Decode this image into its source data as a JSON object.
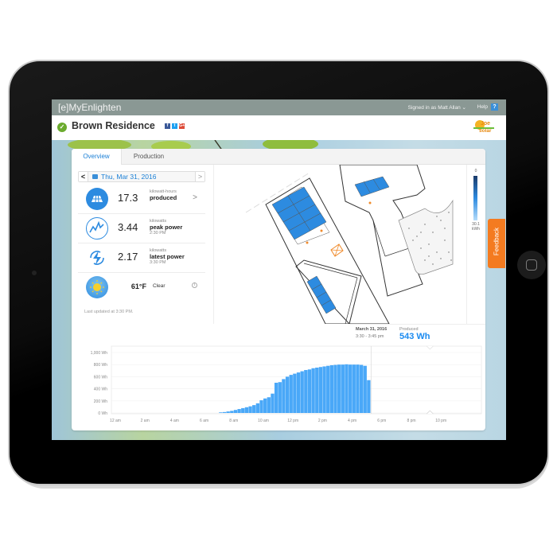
{
  "app": {
    "logo": "[e]MyEnlighten",
    "signed_in": "Signed in as Matt Allan ⌄",
    "help_label": "Help",
    "help_icon": "?"
  },
  "site": {
    "title": "Brown Residence",
    "status": "ok",
    "social": [
      "f",
      "t",
      "G+"
    ],
    "installer_logo_line1": "Joe",
    "installer_logo_line2": "solar"
  },
  "tabs": [
    {
      "label": "Overview",
      "active": true
    },
    {
      "label": "Production",
      "active": false
    }
  ],
  "date_nav": {
    "prev": "<",
    "date": "Thu, Mar 31, 2016",
    "next": ">"
  },
  "stats": {
    "energy": {
      "value": "17.3",
      "unit": "kilowatt-hours",
      "label": "produced",
      "chevron": ">"
    },
    "peak": {
      "value": "3.44",
      "unit": "kilowatts",
      "label": "peak power",
      "time": "2:30 PM"
    },
    "latest": {
      "value": "2.17",
      "unit": "kilowatts",
      "label": "latest power",
      "time": "3:30 PM"
    },
    "weather": {
      "value": "61°F",
      "desc": "Clear",
      "info": "i"
    }
  },
  "last_updated": "Last updated at 3:30 PM.",
  "legend": {
    "min": "0",
    "max": "30.1",
    "unit": "kWh"
  },
  "tooltip": {
    "date": "March 31, 2016",
    "range": "3:30 - 3:45 pm",
    "label": "Produced",
    "value": "543 Wh"
  },
  "feedback_label": "Feedback",
  "colors": {
    "accent": "#1a8af0",
    "bar": "#4aa8f8",
    "feedback": "#f47b20",
    "topbar": "#8a9894"
  },
  "chart_data": {
    "type": "bar",
    "title": "",
    "xlabel": "",
    "ylabel": "Wh",
    "interval_minutes": 15,
    "ylim": [
      0,
      1000
    ],
    "yticks": [
      "0 Wh",
      "200 Wh",
      "400 Wh",
      "600 Wh",
      "800 Wh",
      "1,000 Wh"
    ],
    "ytick_values": [
      0,
      200,
      400,
      600,
      800,
      1000
    ],
    "xticks": [
      "12 am",
      "2 am",
      "4 am",
      "6 am",
      "8 am",
      "10 am",
      "12 pm",
      "2 pm",
      "4 pm",
      "6 pm",
      "8 pm",
      "10 pm"
    ],
    "start_hour": 7,
    "values": [
      10,
      15,
      25,
      35,
      50,
      65,
      80,
      95,
      110,
      130,
      160,
      210,
      240,
      260,
      320,
      500,
      510,
      560,
      600,
      630,
      650,
      670,
      690,
      710,
      720,
      740,
      750,
      760,
      770,
      780,
      790,
      795,
      800,
      800,
      805,
      800,
      800,
      800,
      795,
      780,
      543
    ],
    "grid": true,
    "highlight_index": 40
  }
}
